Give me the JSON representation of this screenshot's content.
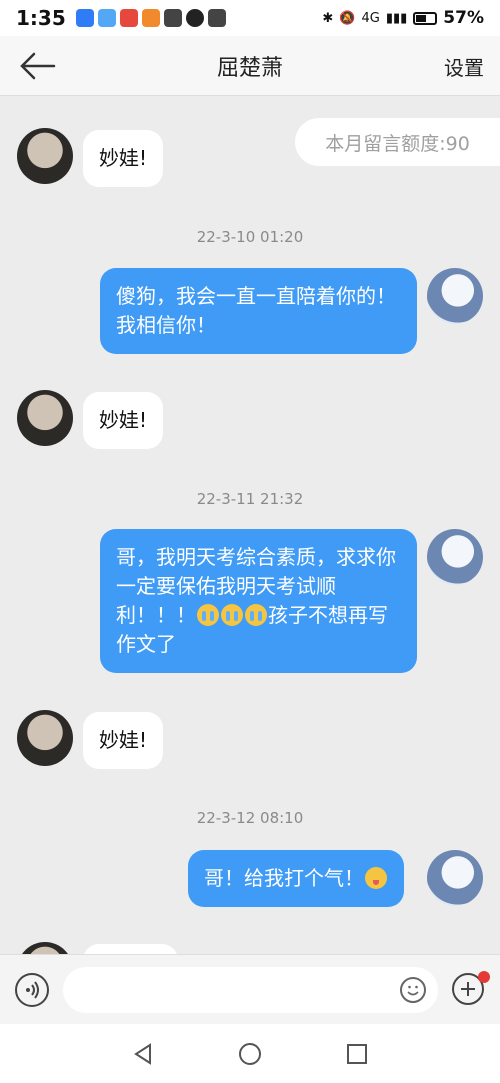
{
  "status_bar": {
    "time": "1:35",
    "battery": "57%",
    "network": "4G"
  },
  "header": {
    "title": "屈楚萧",
    "settings_label": "设置"
  },
  "chat": {
    "quota": "本月留言额度:90",
    "messages": [
      {
        "text": "妙娃!"
      },
      {
        "timestamp": "22-3-10 01:20"
      },
      {
        "text": "傻狗，我会一直一直陪着你的！我相信你！"
      },
      {
        "text": "妙娃!"
      },
      {
        "timestamp": "22-3-11 21:32"
      },
      {
        "text_a": "哥，我明天考综合素质，求求你一定要保佑我明天考试顺利！！！",
        "text_b": "孩子不想再写作文了"
      },
      {
        "text": "妙娃!"
      },
      {
        "timestamp": "22-3-12 08:10"
      },
      {
        "text": "哥！给我打个气！"
      }
    ]
  },
  "input": {
    "placeholder": "",
    "value": ""
  },
  "icons": {
    "back": "back-arrow-icon",
    "voice": "voice-icon",
    "emoji": "emoji-icon",
    "plus": "plus-icon"
  },
  "colors": {
    "outgoing_bubble": "#3f9bf6",
    "incoming_bubble": "#ffffff",
    "background": "#ececec"
  }
}
